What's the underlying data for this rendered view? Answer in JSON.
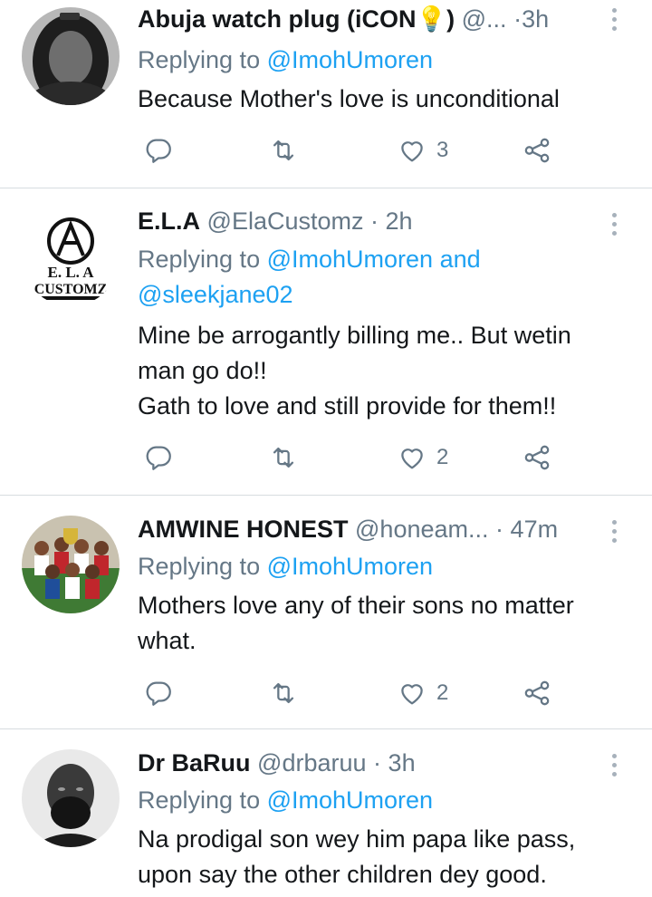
{
  "tweets": [
    {
      "name": "Abuja watch plug (iCON💡)",
      "handle": "@...",
      "time": "3h",
      "reply_prefix": "Replying to",
      "mentions": "@ImohUmoren",
      "text_lines": [
        "Because Mother's love is unconditional"
      ],
      "likes": "3"
    },
    {
      "name": "E.L.A",
      "handle": "@ElaCustomz",
      "time": "2h",
      "reply_prefix": "Replying to",
      "mentions": "@ImohUmoren and",
      "mentions2": "@sleekjane02",
      "text_lines": [
        "Mine be arrogantly billing me.. But wetin",
        "man go do!!",
        "Gath to love and still provide for them!!"
      ],
      "likes": "2",
      "avatar_text": "E. L. A",
      "avatar_text2": "CUSTOMZ"
    },
    {
      "name": "AMWINE HONEST",
      "handle": "@honeam...",
      "time": "47m",
      "reply_prefix": "Replying to",
      "mentions": "@ImohUmoren",
      "text_lines": [
        "Mothers love any of their sons no matter",
        "what."
      ],
      "likes": "2"
    },
    {
      "name": "Dr BaRuu",
      "handle": "@drbaruu",
      "time": "3h",
      "reply_prefix": "Replying to",
      "mentions": "@ImohUmoren",
      "text_lines": [
        "Na prodigal son wey him papa like pass,",
        "upon say the other children dey good."
      ]
    }
  ],
  "colors": {
    "link": "#1da1f2",
    "secondary_text": "#657786",
    "divider": "#d7dce0",
    "icon": "#657786"
  },
  "icons": [
    "reply-icon",
    "retweet-icon",
    "like-icon",
    "share-icon",
    "more-options-icon"
  ]
}
